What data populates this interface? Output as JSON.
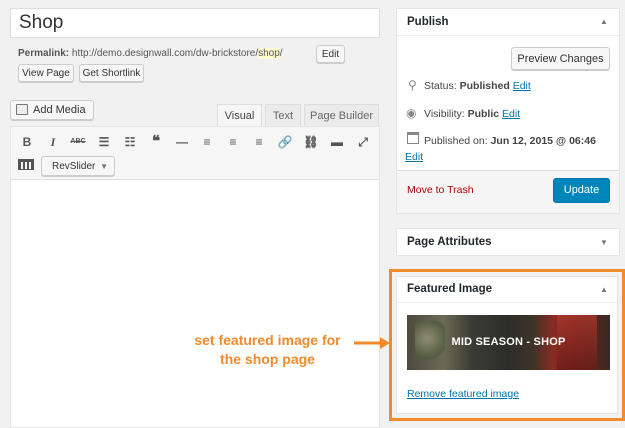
{
  "title": "Shop",
  "permalink": {
    "label": "Permalink:",
    "base": "http://demo.designwall.com/dw-brickstore/",
    "slug": "shop",
    "suffix": "/",
    "edit": "Edit",
    "view_page": "View Page",
    "get_shortlink": "Get Shortlink"
  },
  "editor": {
    "add_media": "Add Media",
    "tabs": [
      "Visual",
      "Text",
      "Page Builder"
    ],
    "toolbar": [
      "B",
      "I",
      "ABC",
      "☰",
      "☷",
      "❝",
      "—",
      "≡",
      "≡",
      "≡",
      "🔗",
      "⛓",
      "▬",
      "⤢"
    ],
    "revslider": "RevSlider"
  },
  "publish": {
    "title": "Publish",
    "preview": "Preview Changes",
    "status_label": "Status:",
    "status_value": "Published",
    "visibility_label": "Visibility:",
    "visibility_value": "Public",
    "published_label": "Published on:",
    "published_value": "Jun 12, 2015 @ 06:46",
    "edit": "Edit",
    "trash": "Move to Trash",
    "update": "Update"
  },
  "page_attributes": {
    "title": "Page Attributes"
  },
  "featured_image": {
    "title": "Featured Image",
    "image_text": "MID SEASON - SHOP",
    "remove": "Remove featured image"
  },
  "annotation": {
    "line1": "set featured image for",
    "line2": "the shop page"
  },
  "colors": {
    "accent": "#f08a2b",
    "update": "#0085ba",
    "link": "#0073aa"
  }
}
